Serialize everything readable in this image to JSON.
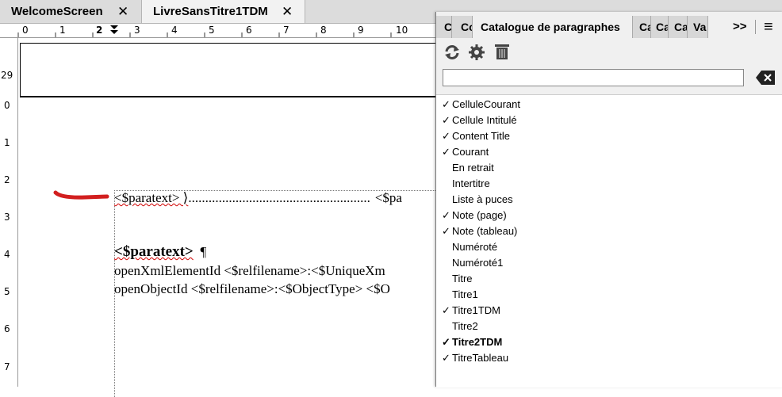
{
  "tabs": [
    {
      "label": "WelcomeScreen",
      "close": "✕"
    },
    {
      "label": "LivreSansTitre1TDM",
      "close": "✕"
    }
  ],
  "hruler": [
    "0",
    "1",
    "2",
    "3",
    "4",
    "5",
    "6",
    "7",
    "8",
    "9",
    "10"
  ],
  "vruler": [
    "29",
    "0",
    "1",
    "2",
    "3",
    "4",
    "5",
    "6",
    "7"
  ],
  "document": {
    "toc_line_start": "<$paratext> ⟩",
    "toc_leader": "......................................................",
    "toc_line_end": "<$pa",
    "heading": "<$paratext>",
    "pilcrow": "¶",
    "line2": "openXmlElementId <$relfilename>:<$UniqueXm",
    "line3": "openObjectId <$relfilename>:<$ObjectType> <$O"
  },
  "panel": {
    "tabs_left": [
      "Co",
      "Co"
    ],
    "active_tab": "Catalogue de paragraphes",
    "tabs_right": [
      "Ca",
      "Ca",
      "Ca",
      "Va"
    ],
    "overflow": ">>",
    "menu": "≡",
    "search": {
      "value": "",
      "placeholder": ""
    },
    "items": [
      {
        "label": "CelluleCourant",
        "check": "✓",
        "bold": false
      },
      {
        "label": "Cellule Intitulé",
        "check": "✓",
        "bold": false
      },
      {
        "label": "Content Title",
        "check": "✓",
        "bold": false
      },
      {
        "label": "Courant",
        "check": "✓",
        "bold": false
      },
      {
        "label": "En retrait",
        "check": "",
        "bold": false
      },
      {
        "label": "Intertitre",
        "check": "",
        "bold": false
      },
      {
        "label": "Liste à puces",
        "check": "",
        "bold": false
      },
      {
        "label": "Note (page)",
        "check": "✓",
        "bold": false
      },
      {
        "label": "Note (tableau)",
        "check": "✓",
        "bold": false
      },
      {
        "label": "Numéroté",
        "check": "",
        "bold": false
      },
      {
        "label": "Numéroté1",
        "check": "",
        "bold": false
      },
      {
        "label": "Titre",
        "check": "",
        "bold": false
      },
      {
        "label": "Titre1",
        "check": "",
        "bold": false
      },
      {
        "label": "Titre1TDM",
        "check": "✓",
        "bold": false
      },
      {
        "label": "Titre2",
        "check": "",
        "bold": false
      },
      {
        "label": "Titre2TDM",
        "check": "✓",
        "bold": true
      },
      {
        "label": "TitreTableau",
        "check": "✓",
        "bold": false
      }
    ]
  },
  "colors": {
    "annotation_stroke": "#d21f1f",
    "spellcheck_underline": "#d00000"
  },
  "icons": [
    "refresh-icon",
    "settings-gear-icon",
    "delete-unused-icon",
    "clear-search-icon",
    "marker-arrow-icon"
  ]
}
